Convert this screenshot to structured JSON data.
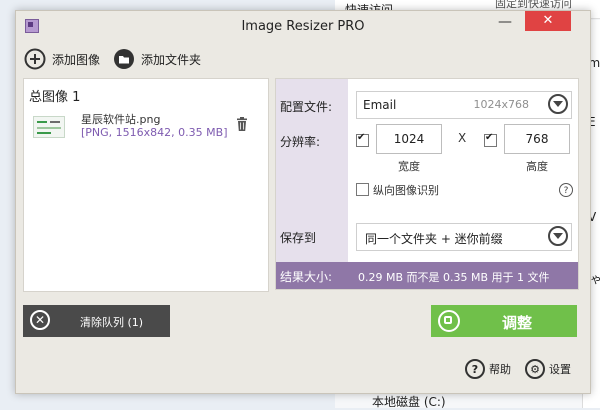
{
  "background": {
    "quick_access": "快速访问",
    "pin_quick_access": "固定到快速访问",
    "fragment_im": "Im",
    "fragment_e": "E",
    "fragment_v": "V",
    "fragment_jp": "ゃ",
    "local_disk": "本地磁盘 (C:)"
  },
  "app": {
    "title": "Image Resizer PRO",
    "minimize_glyph": "—",
    "close_glyph": "✕"
  },
  "toolbar": {
    "add_images": "添加图像",
    "add_folder": "添加文件夹"
  },
  "queue": {
    "total_label": "总图像 1",
    "files": [
      {
        "name": "星辰软件站.png",
        "meta": "[PNG, 1516x842, 0.35 MB]"
      }
    ]
  },
  "settings": {
    "profile_label": "配置文件:",
    "profile_name": "Email",
    "profile_size": "1024x768",
    "resolution_label": "分辨率:",
    "width": "1024",
    "height": "768",
    "size_separator": "X",
    "width_label": "宽度",
    "height_label": "高度",
    "width_checked": true,
    "height_checked": true,
    "portrait_label": "纵向图像识别",
    "portrait_checked": false,
    "portrait_help": "?",
    "save_to_label": "保存到",
    "save_to_option": "同一个文件夹 + 迷你前缀",
    "result_label": "结果大小:",
    "result_text": "0.29 MB 而不是 0.35 MB 用于 1 文件"
  },
  "actions": {
    "clear_queue": "清除队列 (1)",
    "clear_glyph": "✕",
    "adjust": "调整",
    "help": "帮助",
    "help_glyph": "?",
    "settings": "设置",
    "settings_glyph": "⚙"
  },
  "colors": {
    "accent_purple": "#8f77a7",
    "label_column": "#e6e0ec",
    "adjust_green": "#70c04a",
    "clear_dark": "#4a4a4a",
    "close_red": "#e04343"
  }
}
